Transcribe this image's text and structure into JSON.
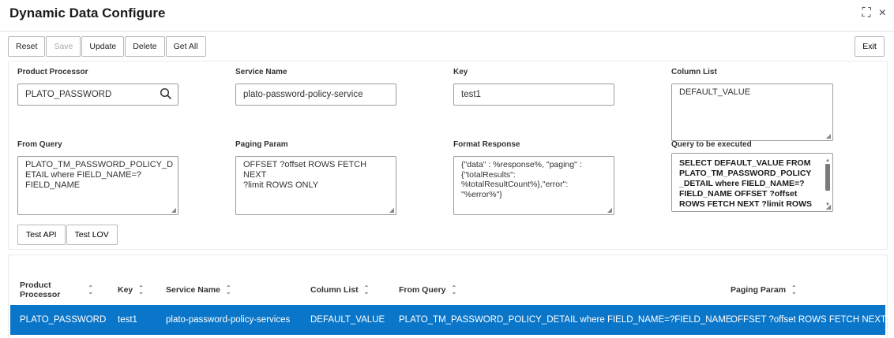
{
  "window": {
    "title": "Dynamic Data Configure",
    "expand_glyph": "⛶",
    "close_glyph": "×"
  },
  "toolbar": {
    "reset": "Reset",
    "save": "Save",
    "update": "Update",
    "delete": "Delete",
    "get_all": "Get All",
    "exit": "Exit"
  },
  "form": {
    "product_processor": {
      "label": "Product Processor",
      "value": "PLATO_PASSWORD"
    },
    "service_name": {
      "label": "Service Name",
      "value": "plato-password-policy-service"
    },
    "key": {
      "label": "Key",
      "value": "test1"
    },
    "column_list": {
      "label": "Column List",
      "value": "DEFAULT_VALUE"
    },
    "from_query": {
      "label": "From Query",
      "lines": [
        "PLATO_TM_PASSWORD_POLICY_D",
        "ETAIL where FIELD_NAME=?",
        "FIELD_NAME"
      ]
    },
    "paging_param": {
      "label": "Paging Param",
      "lines": [
        "OFFSET ?offset ROWS FETCH NEXT",
        "?limit ROWS ONLY"
      ]
    },
    "format_response": {
      "label": "Format Response",
      "lines": [
        "{\"data\" : %response%, \"paging\" :",
        "{\"totalResults\":",
        "%totalResultCount%},\"error\":",
        "\"%error%\"}"
      ]
    },
    "query_to_execute": {
      "label": "Query to be executed",
      "lines": [
        "SELECT DEFAULT_VALUE FROM",
        "PLATO_TM_PASSWORD_POLICY",
        "_DETAIL where FIELD_NAME=?",
        "FIELD_NAME OFFSET ?offset",
        "ROWS FETCH NEXT ?limit ROWS"
      ]
    }
  },
  "actions": {
    "test_api": "Test API",
    "test_lov": "Test LOV"
  },
  "grid": {
    "columns": [
      {
        "lines": [
          "Product",
          "Processor"
        ]
      },
      {
        "lines": [
          "Key"
        ]
      },
      {
        "lines": [
          "Service Name"
        ]
      },
      {
        "lines": [
          "Column List"
        ]
      },
      {
        "lines": [
          "From Query"
        ]
      },
      {
        "lines": [
          "Paging Param"
        ]
      }
    ],
    "rows": [
      [
        "PLATO_PASSWORD",
        "test1",
        "plato-password-policy-services",
        "DEFAULT_VALUE",
        "PLATO_TM_PASSWORD_POLICY_DETAIL where FIELD_NAME=?FIELD_NAME",
        "OFFSET ?offset ROWS FETCH NEXT ?li"
      ]
    ],
    "selected_row_color": "#0a76c9"
  }
}
